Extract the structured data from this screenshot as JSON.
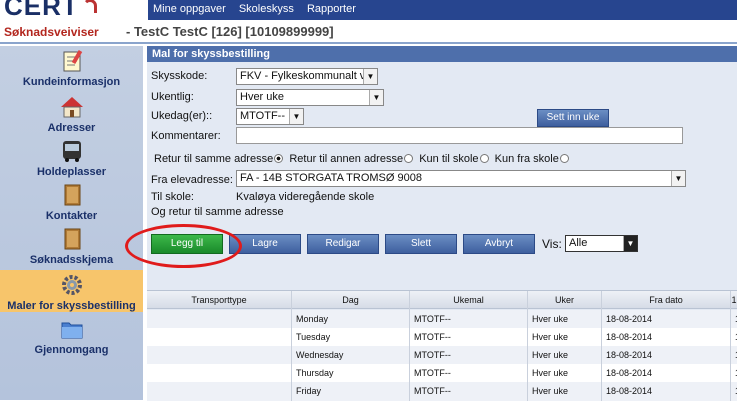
{
  "app": {
    "logo": "CERT",
    "title": "Søknadsveiviser",
    "person": "- TestC TestC [126] [10109899999]"
  },
  "top_nav": [
    "Mine oppgaver",
    "Skoleskyss",
    "Rapporter"
  ],
  "sidebar": [
    {
      "label": "Kundeinformasjon",
      "icon": "notepad-icon"
    },
    {
      "label": "Adresser",
      "icon": "house-icon"
    },
    {
      "label": "Holdeplasser",
      "icon": "bus-icon"
    },
    {
      "label": "Kontakter",
      "icon": "book-icon"
    },
    {
      "label": "Søknadsskjema",
      "icon": "book-icon"
    },
    {
      "label": "Maler for skyssbestilling",
      "icon": "gear-icon",
      "active": true
    },
    {
      "label": "Gjennomgang",
      "icon": "folder-icon"
    }
  ],
  "form": {
    "title": "Mal for skyssbestilling",
    "skysskode_label": "Skysskode:",
    "skysskode_value": "FKV - Fylkeskommunalt v",
    "ukentlig_label": "Ukentlig:",
    "ukentlig_value": "Hver uke",
    "ukedag_label": "Ukedag(er)::",
    "ukedag_value": "MTOTF--",
    "sett_inn_uke": "Sett inn uke",
    "kommentarer_label": "Kommentarer:",
    "kommentarer_value": "",
    "radios": [
      {
        "label": "Retur til samme adresse",
        "checked": true
      },
      {
        "label": "Retur til annen adresse",
        "checked": false
      },
      {
        "label": "Kun til skole",
        "checked": false
      },
      {
        "label": "Kun fra skole",
        "checked": false
      }
    ],
    "fra_label": "Fra elevadresse:",
    "fra_value": "FA - 14B STORGATA TROMSØ 9008",
    "til_label": "Til skole:",
    "til_value": "Kvaløya videregående skole",
    "retur_text": "Og retur til samme adresse"
  },
  "buttons": {
    "legg_til": "Legg til",
    "lagre": "Lagre",
    "redigar": "Redigar",
    "slett": "Slett",
    "avbryt": "Avbryt",
    "vis_label": "Vis:",
    "vis_value": "Alle"
  },
  "table": {
    "columns": [
      "Transporttype",
      "Dag",
      "Ukemal",
      "Uker",
      "Fra dato",
      "1"
    ],
    "rows": [
      [
        "",
        "Monday",
        "MTOTF--",
        "Hver uke",
        "18-08-2014",
        "1"
      ],
      [
        "",
        "Tuesday",
        "MTOTF--",
        "Hver uke",
        "18-08-2014",
        "1"
      ],
      [
        "",
        "Wednesday",
        "MTOTF--",
        "Hver uke",
        "18-08-2014",
        "1"
      ],
      [
        "",
        "Thursday",
        "MTOTF--",
        "Hver uke",
        "18-08-2014",
        "1"
      ],
      [
        "",
        "Friday",
        "MTOTF--",
        "Hver uke",
        "18-08-2014",
        "1"
      ]
    ]
  },
  "colors": {
    "accent": "#27458f",
    "title_red": "#b3261e",
    "highlight": "#e01b1b"
  }
}
